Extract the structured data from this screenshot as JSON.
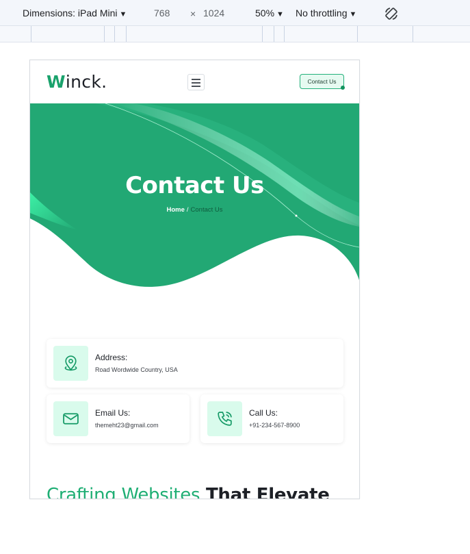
{
  "devtools": {
    "dimensions_label": "Dimensions: iPad Mini",
    "width": "768",
    "times": "×",
    "height": "1024",
    "zoom": "50%",
    "throttling": "No throttling",
    "rotate_icon": "rotate-device-icon"
  },
  "site": {
    "logo_initial": "W",
    "logo_rest": "inck.",
    "header_button": "Contact Us",
    "hero": {
      "title": "Contact Us",
      "breadcrumb_home": "Home",
      "breadcrumb_sep": "/",
      "breadcrumb_current": "Contact Us"
    },
    "contacts": [
      {
        "label": "Address:",
        "value": "Road Wordwide Country, USA",
        "icon": "location-pin-icon"
      },
      {
        "label": "Email Us:",
        "value": "themeht23@gmail.com",
        "icon": "mail-icon"
      },
      {
        "label": "Call Us:",
        "value": "+91-234-567-8900",
        "icon": "phone-icon"
      }
    ],
    "section_heading_accent": "Crafting Websites",
    "section_heading_dark": "That Elevate"
  },
  "colors": {
    "brand_green": "#1aa26c",
    "hero_green": "#22a874",
    "icon_bg": "#d9fbec"
  }
}
